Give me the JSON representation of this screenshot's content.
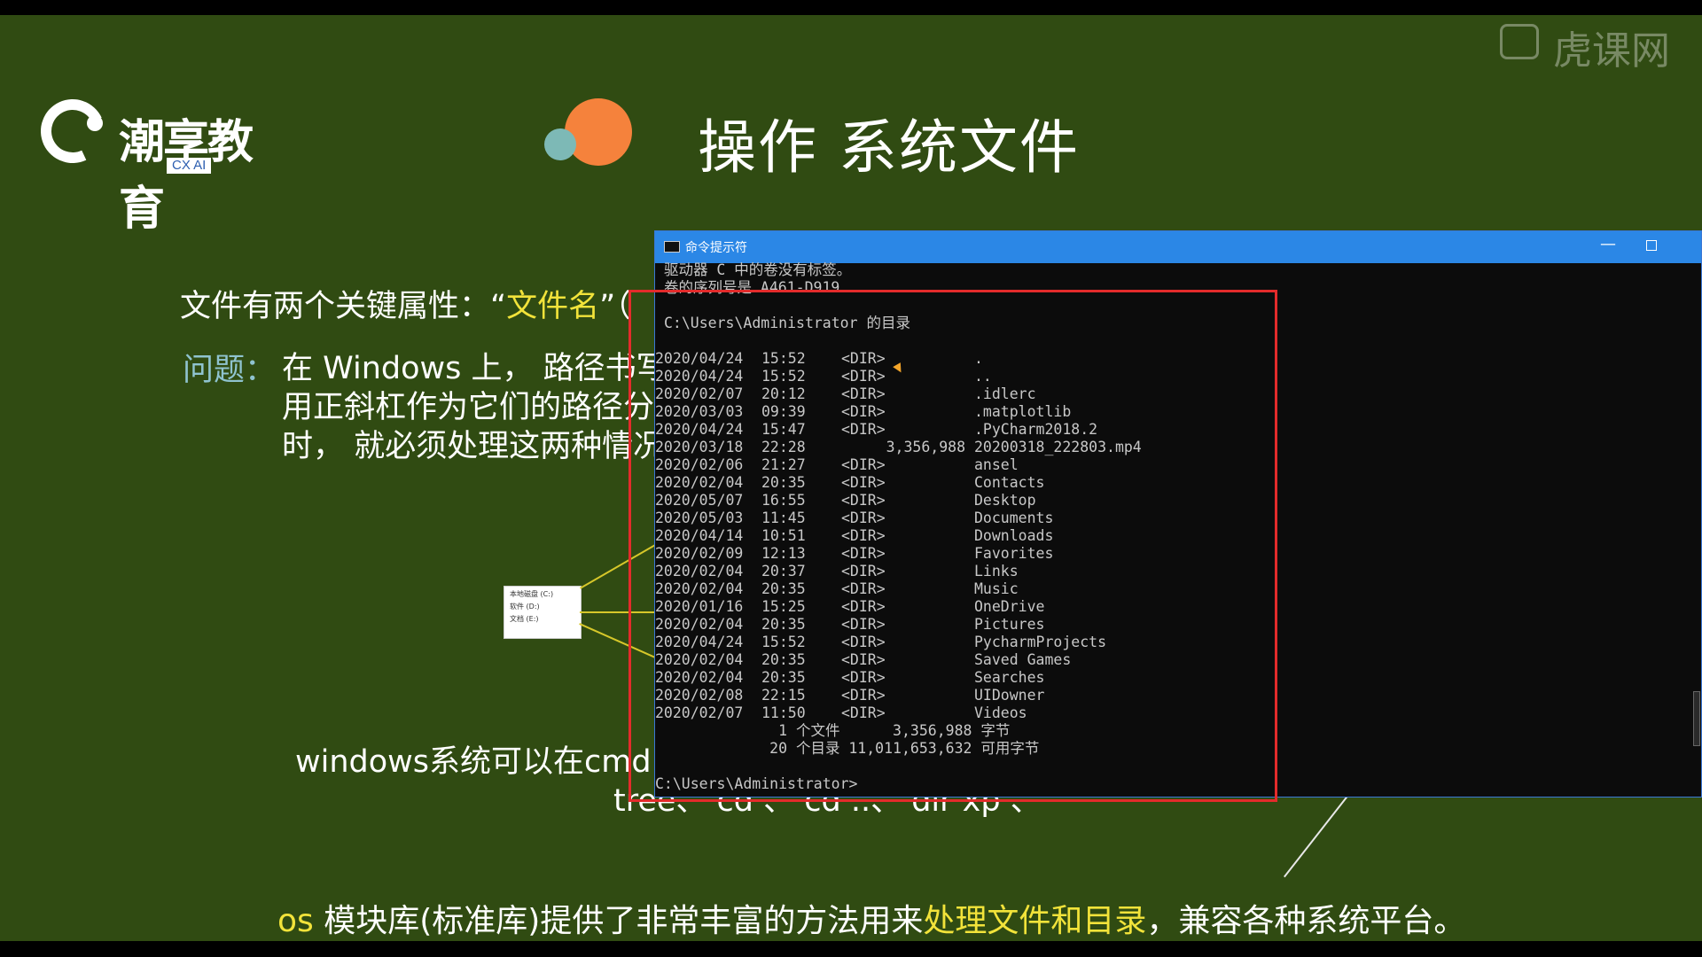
{
  "logo": {
    "name": "潮享教育",
    "sub": "CX AI"
  },
  "watermark": "虎课网",
  "slide_title": "操作 系统文件",
  "line1": {
    "prefix": "文件有两个关键属性：“",
    "highlight": "文件名",
    "suffix": "”（"
  },
  "question": {
    "label": "问题：",
    "lines": [
      "在 Windows 上， 路径书写",
      "用正斜杠作为它们的路径分",
      "时， 就必须处理这两种情况"
    ]
  },
  "thumbnail": {
    "items": [
      "本地磁盘 (C:)",
      "软件 (D:)",
      "文档 (E:)"
    ]
  },
  "windows_line": "windows系统可以在cmd，",
  "commands_line": "tree、 cd 、 cd ..、 dir xp 、",
  "bottom": {
    "prefix": "os ",
    "text1": "模块库(标准库)提供了非常丰富的方法用来",
    "highlight": "处理文件和目录",
    "text2": "，兼容各种系统平台。"
  },
  "cmd": {
    "title": "命令提示符",
    "min_symbol": "—",
    "header": [
      "驱动器 C 中的卷没有标签。",
      "卷的序列号是 A461-D919",
      "",
      "C:\\Users\\Administrator 的目录",
      ""
    ],
    "rows": [
      {
        "date": "2020/04/24",
        "time": "15:52",
        "type": "<DIR>",
        "size": "",
        "name": "."
      },
      {
        "date": "2020/04/24",
        "time": "15:52",
        "type": "<DIR>",
        "size": "",
        "name": ".."
      },
      {
        "date": "2020/02/07",
        "time": "20:12",
        "type": "<DIR>",
        "size": "",
        "name": ".idlerc"
      },
      {
        "date": "2020/03/03",
        "time": "09:39",
        "type": "<DIR>",
        "size": "",
        "name": ".matplotlib"
      },
      {
        "date": "2020/04/24",
        "time": "15:47",
        "type": "<DIR>",
        "size": "",
        "name": ".PyCharm2018.2"
      },
      {
        "date": "2020/03/18",
        "time": "22:28",
        "type": "",
        "size": "3,356,988",
        "name": "20200318_222803.mp4"
      },
      {
        "date": "2020/02/06",
        "time": "21:27",
        "type": "<DIR>",
        "size": "",
        "name": "ansel"
      },
      {
        "date": "2020/02/04",
        "time": "20:35",
        "type": "<DIR>",
        "size": "",
        "name": "Contacts"
      },
      {
        "date": "2020/05/07",
        "time": "16:55",
        "type": "<DIR>",
        "size": "",
        "name": "Desktop"
      },
      {
        "date": "2020/05/03",
        "time": "11:45",
        "type": "<DIR>",
        "size": "",
        "name": "Documents"
      },
      {
        "date": "2020/04/14",
        "time": "10:51",
        "type": "<DIR>",
        "size": "",
        "name": "Downloads"
      },
      {
        "date": "2020/02/09",
        "time": "12:13",
        "type": "<DIR>",
        "size": "",
        "name": "Favorites"
      },
      {
        "date": "2020/02/04",
        "time": "20:37",
        "type": "<DIR>",
        "size": "",
        "name": "Links"
      },
      {
        "date": "2020/02/04",
        "time": "20:35",
        "type": "<DIR>",
        "size": "",
        "name": "Music"
      },
      {
        "date": "2020/01/16",
        "time": "15:25",
        "type": "<DIR>",
        "size": "",
        "name": "OneDrive"
      },
      {
        "date": "2020/02/04",
        "time": "20:35",
        "type": "<DIR>",
        "size": "",
        "name": "Pictures"
      },
      {
        "date": "2020/04/24",
        "time": "15:52",
        "type": "<DIR>",
        "size": "",
        "name": "PycharmProjects"
      },
      {
        "date": "2020/02/04",
        "time": "20:35",
        "type": "<DIR>",
        "size": "",
        "name": "Saved Games"
      },
      {
        "date": "2020/02/04",
        "time": "20:35",
        "type": "<DIR>",
        "size": "",
        "name": "Searches"
      },
      {
        "date": "2020/02/08",
        "time": "22:15",
        "type": "<DIR>",
        "size": "",
        "name": "UIDowner"
      },
      {
        "date": "2020/02/07",
        "time": "11:50",
        "type": "<DIR>",
        "size": "",
        "name": "Videos"
      }
    ],
    "summary": [
      "              1 个文件      3,356,988 字节",
      "             20 个目录 11,011,653,632 可用字节"
    ],
    "prompt": "C:\\Users\\Administrator>"
  },
  "colors": {
    "background": "#304b12",
    "highlight": "#f2e33a",
    "accent_teal": "#8fc3cf",
    "titlebar": "#2b87e6",
    "annotation_box": "#e32b2b"
  }
}
